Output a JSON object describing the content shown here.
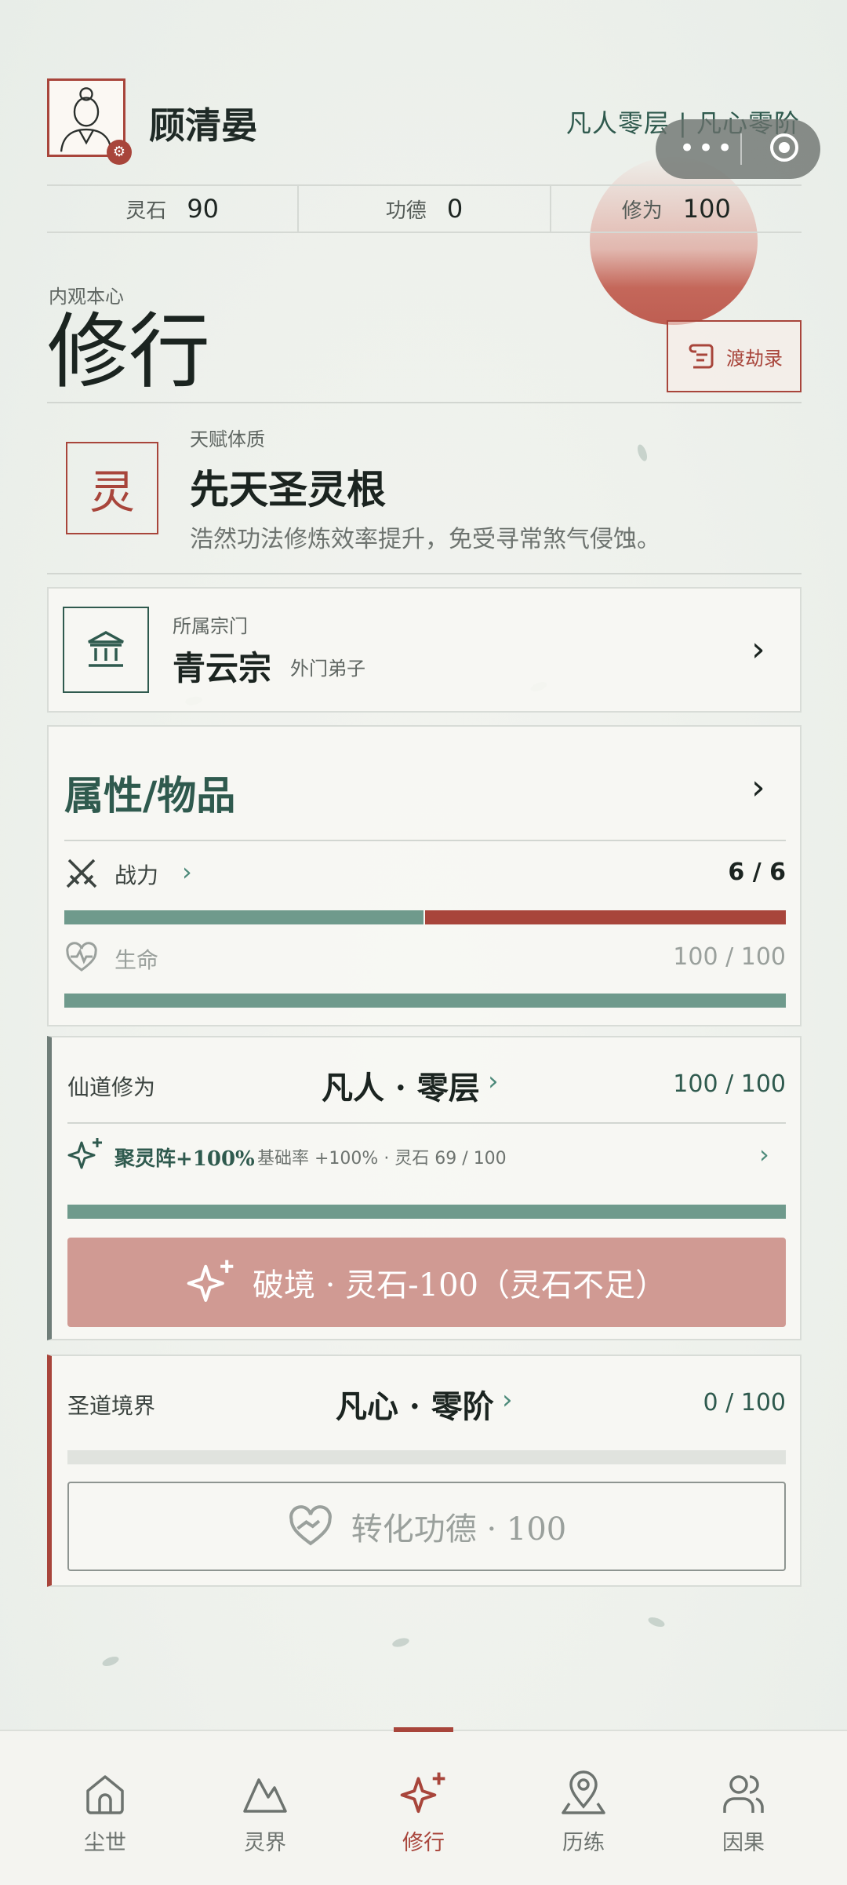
{
  "user": {
    "name": "顾清晏",
    "realm_summary": "凡人零层 | 凡心零阶"
  },
  "stats": [
    {
      "label": "灵石",
      "value": "90"
    },
    {
      "label": "功德",
      "value": "0"
    },
    {
      "label": "修为",
      "value": "100"
    }
  ],
  "page": {
    "subtitle": "内观本心",
    "title": "修行",
    "dujie_label": "渡劫录"
  },
  "talent": {
    "seal": "灵",
    "tag": "天赋体质",
    "name": "先天圣灵根",
    "desc": "浩然功法修炼效率提升，免受寻常煞气侵蚀。"
  },
  "sect": {
    "tag": "所属宗门",
    "name": "青云宗",
    "rank": "外门弟子"
  },
  "attributes": {
    "title": "属性/物品",
    "combat": {
      "label": "战力",
      "value": "6 / 6",
      "fraction_green": 0.5
    },
    "hp": {
      "label": "生命",
      "value": "100 / 100",
      "fraction": 1.0
    }
  },
  "xiandao": {
    "label": "仙道修为",
    "realm": "凡人 · 零层",
    "value": "100 / 100",
    "progress": 1.0,
    "array_label": "聚灵阵+100%",
    "array_detail": "基础率 +100% · 灵石 69 / 100",
    "break_label": "破境 · 灵石-100（灵石不足）"
  },
  "shengdao": {
    "label": "圣道境界",
    "realm": "凡心 · 零阶",
    "value": "0 / 100",
    "progress": 0.0,
    "convert_label": "转化功德 · 100"
  },
  "tabs": [
    {
      "label": "尘世",
      "icon": "home-icon"
    },
    {
      "label": "灵界",
      "icon": "mountain-icon"
    },
    {
      "label": "修行",
      "icon": "sparkle-icon",
      "active": true
    },
    {
      "label": "历练",
      "icon": "map-pin-icon"
    },
    {
      "label": "因果",
      "icon": "users-icon"
    }
  ],
  "colors": {
    "accent_red": "#a8453b",
    "accent_green": "#2f5a4e",
    "bar_green": "#6f9a8c",
    "button_disabled_red": "#d09a93"
  }
}
